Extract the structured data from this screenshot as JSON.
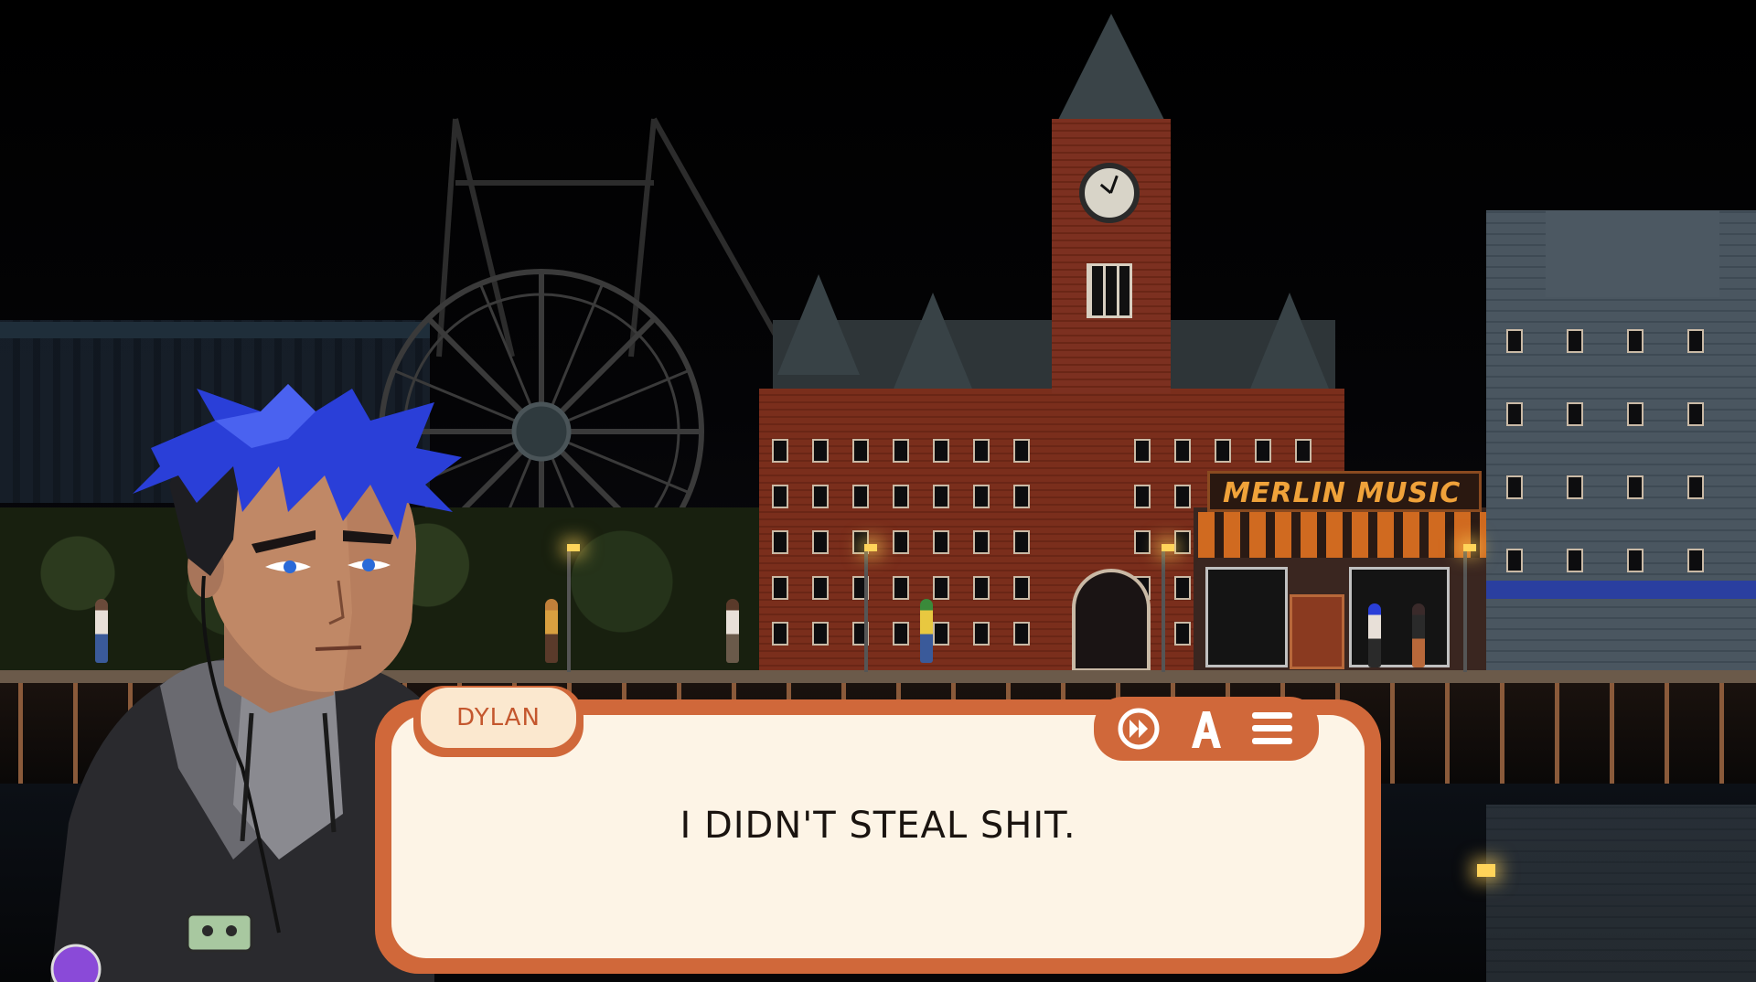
{
  "scene": {
    "store_sign": "MERLIN MUSIC",
    "clock_icon": "clock-icon"
  },
  "dialogue": {
    "speaker": "DYLAN",
    "line": "I DIDN'T STEAL SHIT."
  },
  "controls": {
    "fast_forward_icon": "fast-forward-icon",
    "text_settings_icon": "font-letter-a-icon",
    "menu_icon": "hamburger-menu-icon"
  },
  "colors": {
    "dialogue_frame": "#d0683a",
    "dialogue_background": "#fdf4e6",
    "speaker_text": "#c4572e",
    "hair": "#2a3fd8"
  }
}
